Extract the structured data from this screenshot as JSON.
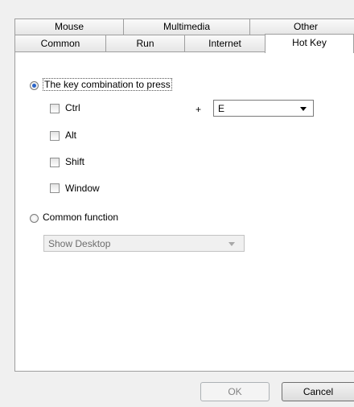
{
  "tabs": {
    "row1": [
      "Mouse",
      "Multimedia",
      "Other"
    ],
    "row2": [
      "Common",
      "Run",
      "Internet",
      "Hot Key"
    ],
    "active": "Hot Key"
  },
  "hotkey": {
    "key_combo_label": "The key combination to press",
    "key_combo_selected": true,
    "modifiers": {
      "ctrl": {
        "label": "Ctrl",
        "checked": false
      },
      "alt": {
        "label": "Alt",
        "checked": false
      },
      "shift": {
        "label": "Shift",
        "checked": false
      },
      "window": {
        "label": "Window",
        "checked": false
      }
    },
    "plus": "+",
    "key_value": "E",
    "common_function_label": "Common function",
    "common_function_selected": false,
    "common_function_value": "Show Desktop"
  },
  "buttons": {
    "ok": "OK",
    "cancel": "Cancel"
  },
  "icons": [
    "chevron-down-icon"
  ]
}
